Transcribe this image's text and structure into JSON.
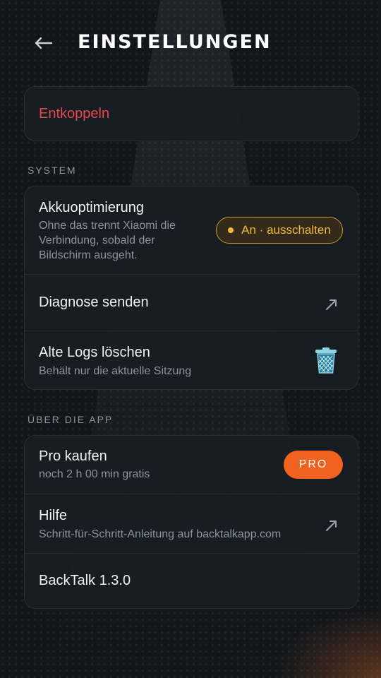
{
  "header": {
    "title": "EINSTELLUNGEN",
    "back_icon": "arrow-left-icon"
  },
  "account": {
    "unpair_label": "Entkoppeln",
    "unpair_color": "#e5484d"
  },
  "system": {
    "section_title": "SYSTEM",
    "battery": {
      "label": "Akkuoptimierung",
      "description": "Ohne das trennt Xiaomi die Verbindung, sobald der Bildschirm ausgeht.",
      "status_button": "An · ausschalten",
      "status_color": "#f0b93d"
    },
    "diagnostics": {
      "label": "Diagnose senden",
      "icon": "external-link-icon"
    },
    "logs": {
      "label": "Alte Logs löschen",
      "description": "Behält nur die aktuelle Sitzung",
      "icon": "trash-icon"
    }
  },
  "about": {
    "section_title": "ÜBER DIE APP",
    "pro": {
      "label": "Pro kaufen",
      "description": "noch 2 h 00 min gratis",
      "button": "PRO",
      "button_color": "#f0621d"
    },
    "help": {
      "label": "Hilfe",
      "description": "Schritt-für-Schritt-Anleitung auf backtalkapp.com",
      "icon": "external-link-icon"
    },
    "version": {
      "label": "BackTalk 1.3.0"
    }
  }
}
